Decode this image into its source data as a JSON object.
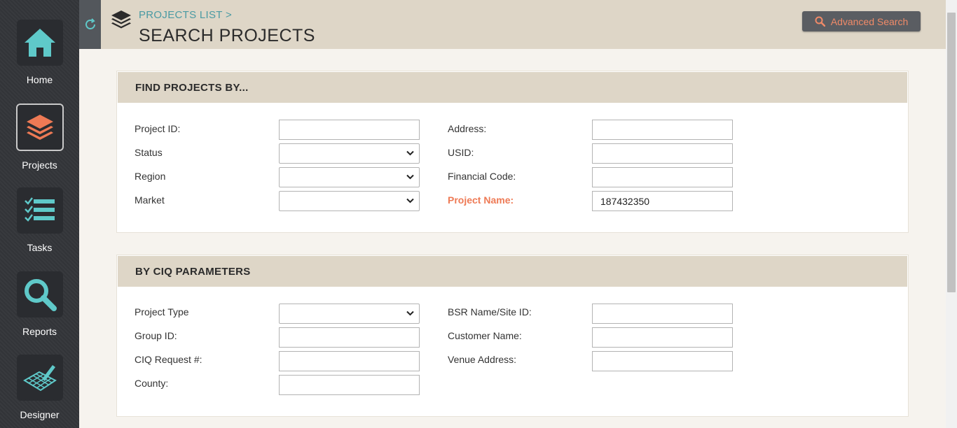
{
  "sidebar": {
    "items": [
      {
        "label": "Home",
        "icon": "home-icon"
      },
      {
        "label": "Projects",
        "icon": "layers-icon",
        "active": true
      },
      {
        "label": "Tasks",
        "icon": "checklist-icon"
      },
      {
        "label": "Reports",
        "icon": "search-icon"
      },
      {
        "label": "Designer",
        "icon": "designer-icon"
      }
    ]
  },
  "header": {
    "breadcrumb": "PROJECTS LIST  >",
    "title": "SEARCH PROJECTS",
    "advanced_search_label": "Advanced Search"
  },
  "find_panel": {
    "title": "FIND PROJECTS BY...",
    "left_fields": [
      {
        "label": "Project ID:",
        "type": "text",
        "value": ""
      },
      {
        "label": "Status",
        "type": "select",
        "value": ""
      },
      {
        "label": "Region",
        "type": "select",
        "value": ""
      },
      {
        "label": "Market",
        "type": "select",
        "value": ""
      }
    ],
    "right_fields": [
      {
        "label": "Address:",
        "type": "text",
        "value": ""
      },
      {
        "label": "USID:",
        "type": "text",
        "value": ""
      },
      {
        "label": "Financial Code:",
        "type": "text",
        "value": ""
      },
      {
        "label": "Project Name:",
        "type": "text",
        "value": "187432350"
      }
    ]
  },
  "ciq_panel": {
    "title": "BY CIQ PARAMETERS",
    "left_fields": [
      {
        "label": "Project Type",
        "type": "select",
        "value": ""
      },
      {
        "label": "Group ID:",
        "type": "text",
        "value": ""
      },
      {
        "label": "CIQ Request #:",
        "type": "text",
        "value": ""
      },
      {
        "label": "County:",
        "type": "text",
        "value": ""
      }
    ],
    "right_fields": [
      {
        "label": "BSR Name/Site ID:",
        "type": "text",
        "value": ""
      },
      {
        "label": "Customer Name:",
        "type": "text",
        "value": ""
      },
      {
        "label": "Venue Address:",
        "type": "text",
        "value": ""
      }
    ]
  },
  "colors": {
    "accent_teal": "#5fc9c9",
    "accent_orange": "#ee7a55",
    "header_bg": "#ded6c7",
    "sidebar_bg": "#34363a"
  }
}
